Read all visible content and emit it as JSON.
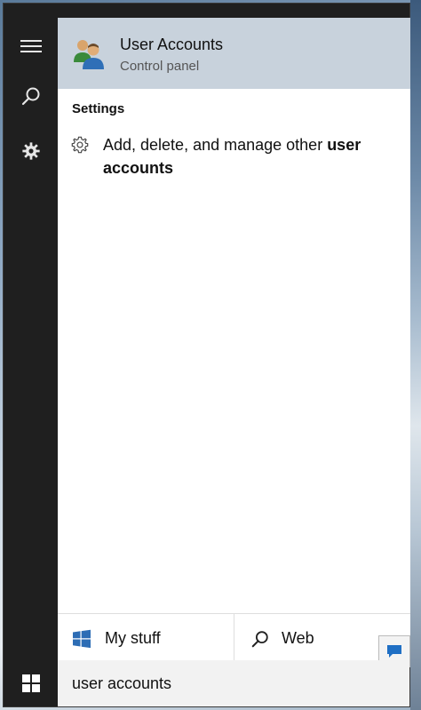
{
  "rail": {
    "menu_icon": "hamburger-icon",
    "search_icon": "search-icon",
    "settings_icon": "gear-icon"
  },
  "best_match": {
    "title": "User Accounts",
    "subtitle": "Control panel",
    "icon": "user-accounts-icon"
  },
  "settings": {
    "heading": "Settings",
    "items": [
      {
        "text_normal": "Add, delete, and manage other ",
        "text_bold": "user accounts",
        "icon": "gear-outline-icon"
      }
    ]
  },
  "scopes": {
    "my_stuff": "My stuff",
    "web": "Web"
  },
  "search": {
    "value": "user accounts"
  },
  "colors": {
    "rail_bg": "#1f1f1f",
    "highlight_bg": "#c8d2dc",
    "panel_bg": "#ffffff",
    "search_bg": "#f2f2f2",
    "accent_blue": "#1f6fc4"
  }
}
